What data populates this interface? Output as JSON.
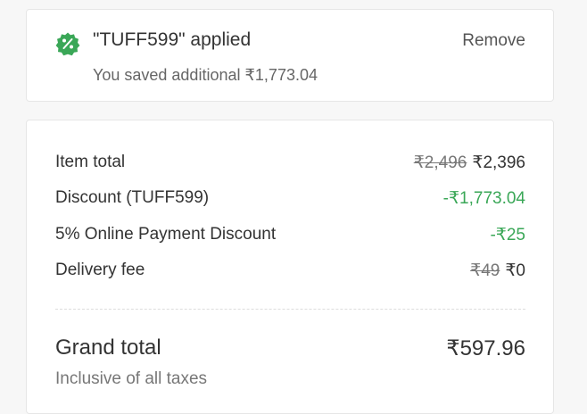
{
  "coupon": {
    "icon": "percent-badge-icon",
    "title": "\"TUFF599\" applied",
    "saved_text": "You saved additional ₹1,773.04",
    "remove_label": "Remove",
    "accent_color": "#3aa757"
  },
  "bill": {
    "items": [
      {
        "label": "Item total",
        "original": "₹2,496",
        "value": "₹2,396",
        "is_discount": false
      },
      {
        "label": "Discount (TUFF599)",
        "original": "",
        "value": "-₹1,773.04",
        "is_discount": true
      },
      {
        "label": "5% Online Payment Discount",
        "original": "",
        "value": "-₹25",
        "is_discount": true
      },
      {
        "label": "Delivery fee",
        "original": "₹49",
        "value": "₹0",
        "is_discount": false
      }
    ],
    "grand_total_label": "Grand total",
    "grand_total_value": "₹597.96",
    "tax_note": "Inclusive of all taxes"
  }
}
